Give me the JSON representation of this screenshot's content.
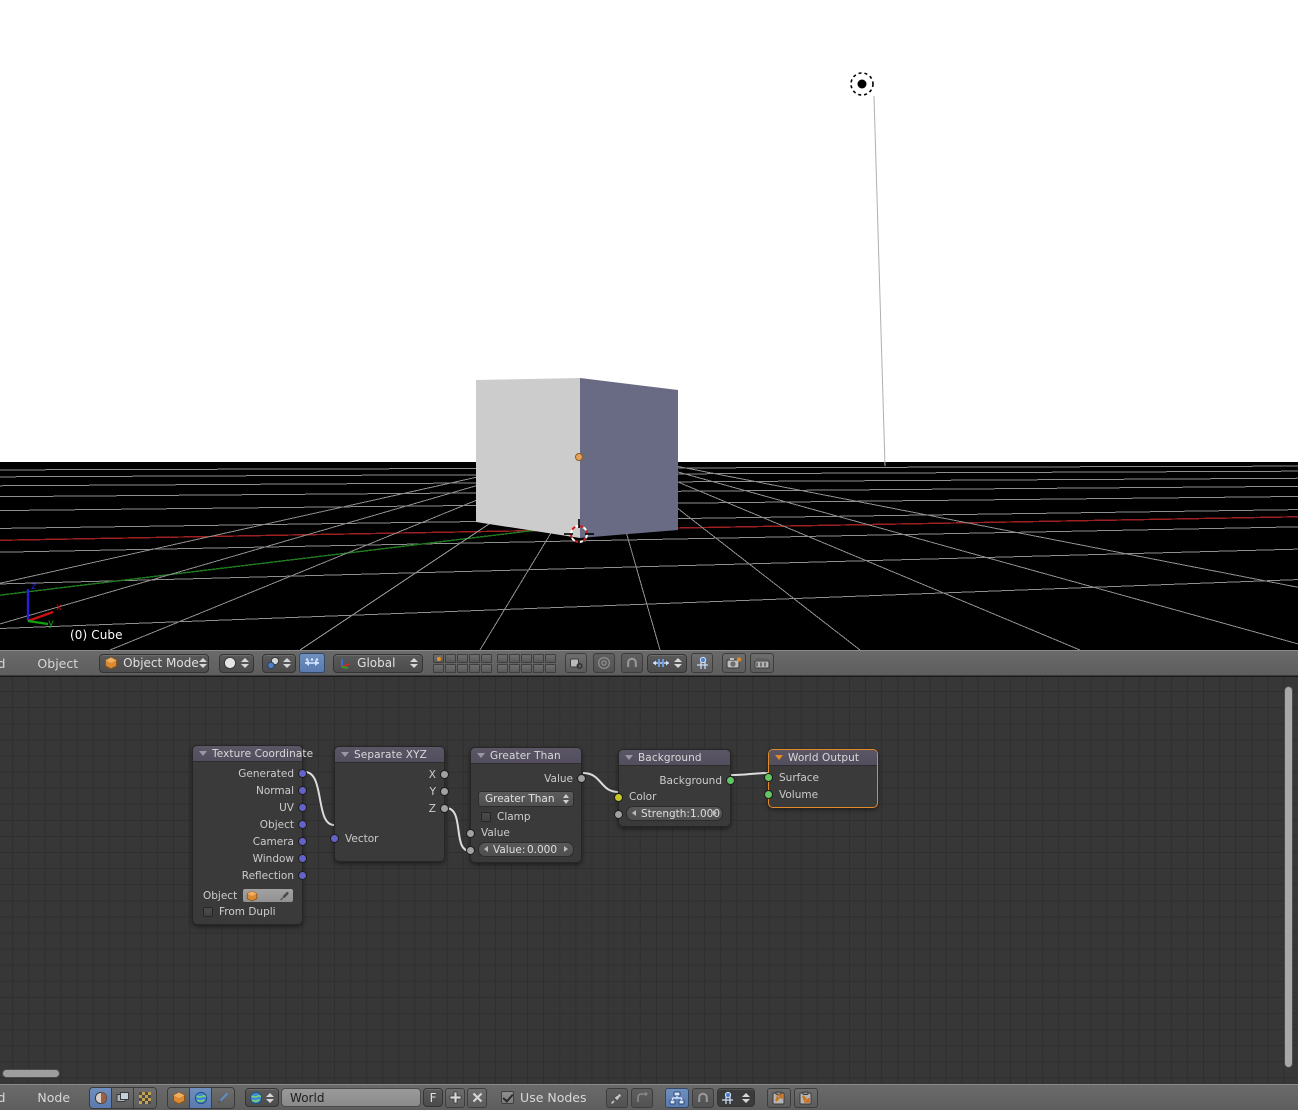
{
  "viewport": {
    "object_info": "(0) Cube",
    "axis_gizmo": {
      "x_label": "x",
      "y_label": "y",
      "z_label": "z"
    },
    "sky_color": "#ffffff",
    "ground_color": "#000000",
    "grid_color": "#8f8f8f",
    "x_axis_color": "#9c2020",
    "y_axis_color": "#1f7a1f",
    "cube_light_face": "#cccccc",
    "cube_dark_face": "#696b84",
    "origin_color": "#e8a260"
  },
  "viewport_header": {
    "menu_add": "ld",
    "menu_object": "Object",
    "mode_label": "Object Mode",
    "transform_orientation": "Global",
    "icons": {
      "mode_cube": "cube-icon",
      "shading": "sphere-shading-icon",
      "pivot": "pivot-icon",
      "manipulator": "manipulator-icon",
      "axis": "axis-widget-icon",
      "snap_magnet": "magnet-icon",
      "proportional": "proportional-edit-icon",
      "render": "camera-render-icon",
      "animation": "clapperboard-icon",
      "local_view": "local-view-icon",
      "texture_paint": "texture-icon"
    }
  },
  "node_editor": {
    "nodes": [
      {
        "id": "texcoord",
        "title": "Texture Coordinate",
        "selected": false,
        "outputs": [
          "Generated",
          "Normal",
          "UV",
          "Object",
          "Camera",
          "Window",
          "Reflection"
        ],
        "object_label": "Object",
        "object_value": "",
        "from_dupli_label": "From Dupli",
        "from_dupli_checked": false
      },
      {
        "id": "separatexyz",
        "title": "Separate XYZ",
        "selected": false,
        "outputs": [
          "X",
          "Y",
          "Z"
        ],
        "inputs": [
          "Vector"
        ]
      },
      {
        "id": "greaterthan",
        "title": "Greater Than",
        "selected": false,
        "outputs": [
          "Value"
        ],
        "operation": "Greater Than",
        "clamp_label": "Clamp",
        "clamp_checked": false,
        "input_a_label": "Value",
        "input_b_label": "Value:",
        "input_b_value": "0.000"
      },
      {
        "id": "background",
        "title": "Background",
        "selected": false,
        "outputs": [
          "Background"
        ],
        "color_label": "Color",
        "strength_label": "Strength:",
        "strength_value": "1.000"
      },
      {
        "id": "worldoutput",
        "title": "World Output",
        "selected": true,
        "inputs": [
          "Surface",
          "Volume"
        ]
      }
    ],
    "links": [
      {
        "from": "texcoord.Generated",
        "to": "separatexyz.Vector"
      },
      {
        "from": "separatexyz.Z",
        "to": "greaterthan.Value"
      },
      {
        "from": "greaterthan.Value",
        "to": "background.Color"
      },
      {
        "from": "background.Background",
        "to": "worldoutput.Surface"
      }
    ],
    "socket_colors": {
      "vector": "#6363c7",
      "value": "#a1a1a1",
      "color": "#c7c729",
      "shader": "#62c762"
    },
    "background": "#373737",
    "grid_line": "#2f2f2f"
  },
  "node_header": {
    "menu_add": "ld",
    "menu_node": "Node",
    "datablock_value": "World",
    "fake_user_label": "F",
    "use_nodes_label": "Use Nodes",
    "use_nodes_checked": true,
    "icons": {
      "shader_editor": "shader-nodetree-icon",
      "compositor": "compositing-nodetree-icon",
      "texture_nodes": "texture-nodetree-icon",
      "object_shader": "object-shader-icon",
      "world_shader": "world-globe-icon",
      "brush_shader": "brush-icon",
      "world_datablock": "world-globe-icon",
      "add_datablock": "plus-icon",
      "unlink_datablock": "x-unlink-icon",
      "pin": "pin-icon",
      "go_parent": "go-to-parent-icon",
      "auto_offset": "auto-offset-icon",
      "snap_magnet": "magnet-icon",
      "snap_node_element": "snap-node-icon",
      "copy_to_clipboard": "copy-icon",
      "paste_from_clipboard": "paste-icon"
    }
  }
}
